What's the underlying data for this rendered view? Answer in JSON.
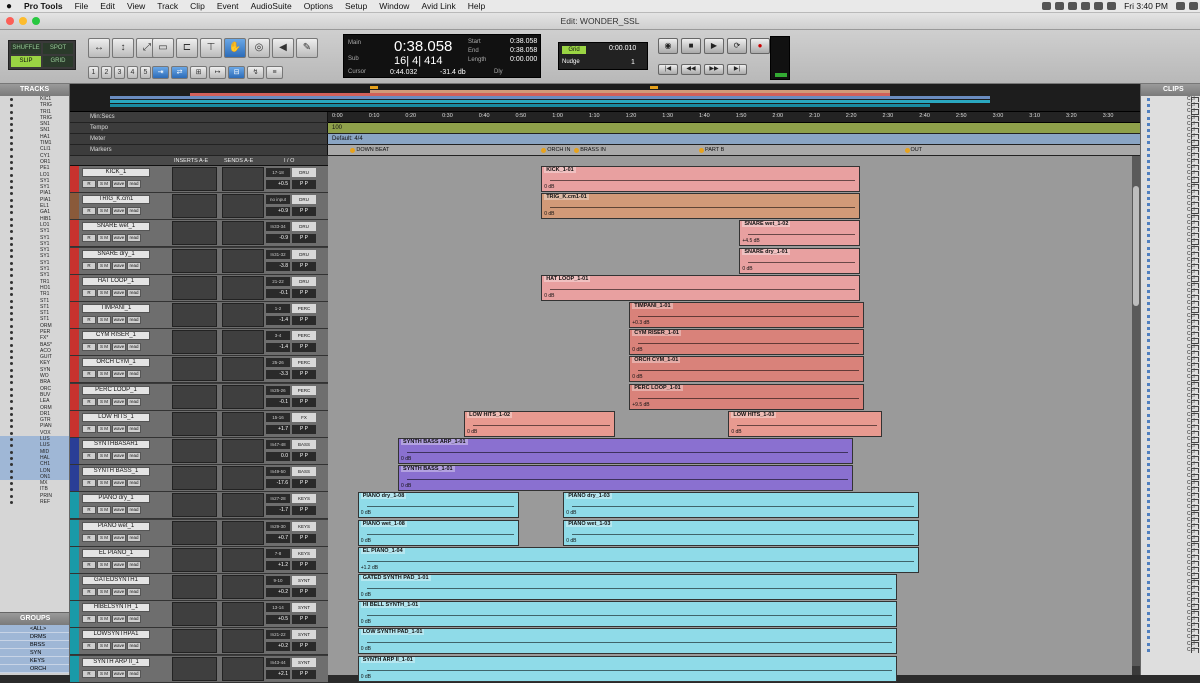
{
  "menubar": {
    "app_name": "Pro Tools",
    "items": [
      "File",
      "Edit",
      "View",
      "Track",
      "Clip",
      "Event",
      "AudioSuite",
      "Options",
      "Setup",
      "Window",
      "Avid Link",
      "Help"
    ],
    "clock": "Fri 3:40 PM"
  },
  "window": {
    "title": "Edit: WONDER_SSL"
  },
  "toolbar": {
    "modes": [
      "SHUFFLE",
      "SPOT",
      "SLIP",
      "GRID"
    ],
    "active_mode": "SLIP",
    "zoom_presets": [
      "1",
      "2",
      "3",
      "4",
      "5"
    ]
  },
  "counter": {
    "main_label": "Main",
    "main_value": "0:38.058",
    "sub_label": "Sub",
    "sub_value": "16| 4| 414",
    "start_label": "Start",
    "start_value": "0:38.058",
    "end_label": "End",
    "end_value": "0:38.058",
    "length_label": "Length",
    "length_value": "0:00.000",
    "cursor_label": "Cursor",
    "cursor_value": "0:44.032",
    "cursor_db": "-31.4 db",
    "dly_label": "Dly"
  },
  "grid": {
    "label": "Grid",
    "value": "0:00.010",
    "nudge_label": "Nudge",
    "nudge_value": "1"
  },
  "panels": {
    "tracks": "TRACKS",
    "groups": "GROUPS",
    "clips": "CLIPS"
  },
  "track_list": [
    "KIC1",
    "TRIG",
    "TRI1",
    "TRIG",
    "SN1",
    "SN1",
    "HA1",
    "TIM1",
    "CLI1",
    "CY1",
    "OR1",
    "PE1",
    "LO1",
    "SY1",
    "SY1",
    "PIA1",
    "PIA1",
    "EL1",
    "GA1",
    "HIB1",
    "LO1",
    "SY1",
    "SY1",
    "SY1",
    "SY1",
    "SY1",
    "SY1",
    "SY1",
    "SY1",
    "TR1",
    "HO1",
    "TR1",
    "ST1",
    "ST1",
    "ST1",
    "ST1",
    "ORM",
    "PER",
    "FX*",
    "BAS*",
    "ACO",
    "GUIT",
    "KEY",
    "SYN",
    "WO",
    "BRA",
    "ORC",
    "BUV",
    "LEA",
    "ORM",
    "DR1",
    "GTR",
    "PIAN",
    "VOX",
    "LUS",
    "LUS",
    "MID",
    "HAL",
    "CH1",
    "LON",
    "ON1",
    "MX",
    "ITB",
    "PRIN",
    "REF"
  ],
  "groups": [
    "<ALL>",
    "DRMS",
    "BRSS",
    "SYN",
    "KEYS",
    "ORCH"
  ],
  "ruler": {
    "rows": [
      "Min:Secs",
      "Tempo",
      "Meter",
      "Markers"
    ],
    "ticks": [
      "0:00",
      "0:10",
      "0:20",
      "0:30",
      "0:40",
      "0:50",
      "1:00",
      "1:10",
      "1:20",
      "1:30",
      "1:40",
      "1:50",
      "2:00",
      "2:10",
      "2:20",
      "2:30",
      "2:40",
      "2:50",
      "3:00",
      "3:10",
      "3:20",
      "3:30"
    ],
    "tempo_value": "100",
    "meter_value": "Default: 4/4",
    "markers": [
      {
        "label": "DOWN BEAT",
        "t": 5
      },
      {
        "label": "ORCH IN",
        "t": 57
      },
      {
        "label": "BRASS IN",
        "t": 66
      },
      {
        "label": "PART B",
        "t": 100
      },
      {
        "label": "OUT",
        "t": 156
      }
    ]
  },
  "columns": {
    "inserts": "INSERTS A-E",
    "sends": "SENDS A-E",
    "io": "I / O"
  },
  "tracks": [
    {
      "name": "KICK_1",
      "color": "#c8322e",
      "io": "17-18",
      "bus": "DRU",
      "vol": "+0.5",
      "pan": "P  P"
    },
    {
      "name": "TRIG_K.cm1",
      "color": "#8a5a3a",
      "io": "no input",
      "bus": "DRU",
      "vol": "+0.9",
      "pan": "P  P"
    },
    {
      "name": "SNARE wet_1",
      "color": "#c8322e",
      "io": "In33-34",
      "bus": "DRU",
      "vol": "-0.9",
      "pan": "P  P"
    },
    {
      "name": "SNARE dry_1",
      "color": "#c8322e",
      "io": "In31-32",
      "bus": "DRU",
      "vol": "-3.8",
      "pan": "P  P"
    },
    {
      "name": "HAT LOOP_1",
      "color": "#c8322e",
      "io": "21-22",
      "bus": "DRU",
      "vol": "-0.1",
      "pan": "P  P"
    },
    {
      "name": "TIMPANI_1",
      "color": "#c8322e",
      "io": "1-2",
      "bus": "PERC",
      "vol": "-1.4",
      "pan": "P  P"
    },
    {
      "name": "CYM RISER_1",
      "color": "#c8322e",
      "io": "3-4",
      "bus": "PERC",
      "vol": "-1.4",
      "pan": "P  P"
    },
    {
      "name": "ORCH CYM_1",
      "color": "#c8322e",
      "io": "25-26",
      "bus": "PERC",
      "vol": "-3.3",
      "pan": "P  P"
    },
    {
      "name": "PERC LOOP_1",
      "color": "#c8322e",
      "io": "In25-26",
      "bus": "PERC",
      "vol": "-0.1",
      "pan": "P  P"
    },
    {
      "name": "LOW HITS_1",
      "color": "#c8322e",
      "io": "15-16",
      "bus": "FX",
      "vol": "+1.7",
      "pan": "P  P"
    },
    {
      "name": "SYNTHBASAR1",
      "color": "#2a3e96",
      "io": "In47-48",
      "bus": "BASS",
      "vol": "0.0",
      "pan": "P  P"
    },
    {
      "name": "SYNTH BASS_1",
      "color": "#2a3e96",
      "io": "In49-50",
      "bus": "BASS",
      "vol": "-17.6",
      "pan": "P  P"
    },
    {
      "name": "PIANO dry_1",
      "color": "#1a9aa8",
      "io": "In27-28",
      "bus": "KEYS",
      "vol": "-1.7",
      "pan": "P  P"
    },
    {
      "name": "PIANO wet_1",
      "color": "#1a9aa8",
      "io": "In29-30",
      "bus": "KEYS",
      "vol": "+0.7",
      "pan": "P  P"
    },
    {
      "name": "EL PIANO_1",
      "color": "#1a9aa8",
      "io": "7-8",
      "bus": "KEYS",
      "vol": "+1.2",
      "pan": "P  P"
    },
    {
      "name": "GATEDSYNTH1",
      "color": "#1a9aa8",
      "io": "9-10",
      "bus": "SYNT",
      "vol": "+0.2",
      "pan": "P  P"
    },
    {
      "name": "HIBELSYNTH_1",
      "color": "#1a9aa8",
      "io": "13-14",
      "bus": "SYNT",
      "vol": "+0.5",
      "pan": "P  P"
    },
    {
      "name": "LOWSYNTHPA1",
      "color": "#1a9aa8",
      "io": "In21-22",
      "bus": "SYNT",
      "vol": "+0.2",
      "pan": "P  P"
    },
    {
      "name": "SYNTH ARP II_1",
      "color": "#1a9aa8",
      "io": "In43-44",
      "bus": "SYNT",
      "vol": "+2.1",
      "pan": "P  P"
    }
  ],
  "clips": [
    {
      "name": "KICK_1-01",
      "gain": "0 dB",
      "track": 0,
      "start": 57,
      "end": 144,
      "color": "#e8a0a0"
    },
    {
      "name": "TRIG_K.cm1-01",
      "gain": "0 dB",
      "track": 1,
      "start": 57,
      "end": 144,
      "color": "#d29a78"
    },
    {
      "name": "SNARE wet_1-02",
      "gain": "+4.5 dB",
      "track": 2,
      "start": 111,
      "end": 144,
      "color": "#e8a0a0"
    },
    {
      "name": "SNARE dry_1-01",
      "gain": "0 dB",
      "track": 3,
      "start": 111,
      "end": 144,
      "color": "#e8a0a0"
    },
    {
      "name": "HAT LOOP_1-01",
      "gain": "0 dB",
      "track": 4,
      "start": 57,
      "end": 144,
      "color": "#e8a0a0"
    },
    {
      "name": "TIMPANI_1-01",
      "gain": "+0.3 dB",
      "track": 5,
      "start": 81,
      "end": 145,
      "color": "#d9827a"
    },
    {
      "name": "CYM RISER_1-01",
      "gain": "0 dB",
      "track": 6,
      "start": 81,
      "end": 145,
      "color": "#d9827a"
    },
    {
      "name": "ORCH CYM_1-01",
      "gain": "0 dB",
      "track": 7,
      "start": 81,
      "end": 145,
      "color": "#d9827a"
    },
    {
      "name": "PERC LOOP_1-01",
      "gain": "+9.5 dB",
      "track": 8,
      "start": 81,
      "end": 145,
      "color": "#d9827a"
    },
    {
      "name": "LOW HITS_1-02",
      "gain": "0 dB",
      "track": 9,
      "start": 36,
      "end": 77,
      "color": "#e89a90"
    },
    {
      "name": "LOW HITS_1-03",
      "gain": "0 dB",
      "track": 9,
      "start": 108,
      "end": 150,
      "color": "#e89a90"
    },
    {
      "name": "SYNTH BASS ARP_1-01",
      "gain": "0 dB",
      "track": 10,
      "start": 18,
      "end": 142,
      "color": "#8a70d0"
    },
    {
      "name": "SYNTH BASS_1-01",
      "gain": "0 dB",
      "track": 11,
      "start": 18,
      "end": 142,
      "color": "#8a70d0"
    },
    {
      "name": "PIANO dry_1-08",
      "gain": "0 dB",
      "track": 12,
      "start": 7,
      "end": 51,
      "color": "#8fdbe8"
    },
    {
      "name": "PIANO dry_1-03",
      "gain": "0 dB",
      "track": 12,
      "start": 63,
      "end": 160,
      "color": "#8fdbe8"
    },
    {
      "name": "PIANO wet_1-08",
      "gain": "0 dB",
      "track": 13,
      "start": 7,
      "end": 51,
      "color": "#8fdbe8"
    },
    {
      "name": "PIANO wet_1-03",
      "gain": "0 dB",
      "track": 13,
      "start": 63,
      "end": 160,
      "color": "#8fdbe8"
    },
    {
      "name": "EL PIANO_1-04",
      "gain": "+1.2 dB",
      "track": 14,
      "start": 7,
      "end": 160,
      "color": "#8fdbe8"
    },
    {
      "name": "GATED SYNTH PAD_1-01",
      "gain": "0 dB",
      "track": 15,
      "start": 7,
      "end": 154,
      "color": "#8fdbe8"
    },
    {
      "name": "HI BELL SYNTH_1-01",
      "gain": "0 dB",
      "track": 16,
      "start": 7,
      "end": 154,
      "color": "#8fdbe8"
    },
    {
      "name": "LOW SYNTH PAD_1-01",
      "gain": "0 dB",
      "track": 17,
      "start": 7,
      "end": 154,
      "color": "#8fdbe8"
    },
    {
      "name": "SYNTH ARP II_1-01",
      "gain": "0 dB",
      "track": 18,
      "start": 7,
      "end": 154,
      "color": "#8fdbe8"
    }
  ],
  "clips_list": [
    "CLI",
    "CLI",
    "CLI",
    "CLI",
    "CLI",
    "CLI",
    "CLI",
    "CLI",
    "CLI",
    "CLI",
    "CLI",
    "CLI",
    "CLI",
    "CLI",
    "CLI",
    "CLI",
    "CLI",
    "CLI",
    "CLI",
    "CLI",
    "CLI",
    "CLI",
    "CLI",
    "CLI",
    "CLI",
    "CLI",
    "CLI",
    "CLI",
    "CLI",
    "CLI",
    "CLI",
    "CLI",
    "CLI",
    "CLI",
    "CLI",
    "CLI",
    "CLI",
    "CLI",
    "CLI",
    "CLI",
    "CLI",
    "CLI",
    "CLI",
    "CLI",
    "CLI",
    "CLI",
    "CLI",
    "CLI",
    "CLI",
    "CLI",
    "CLI",
    "CLI",
    "CLI",
    "CLI",
    "CLI",
    "CLI",
    "CLI",
    "CLI",
    "CLI",
    "CLI",
    "CLI",
    "CLI",
    "CLI",
    "CLI",
    "CLI",
    "CLI",
    "CLI",
    "CLI",
    "CLI",
    "CLI",
    "CLI",
    "CLI",
    "CLI",
    "CLI",
    "CLI",
    "CLI",
    "CLI",
    "CLI",
    "CLI",
    "CLI",
    "CLI",
    "CLI",
    "CLI",
    "CLI",
    "CLI",
    "CLI",
    "CLI",
    "CLI",
    "CLI",
    "CLI"
  ]
}
